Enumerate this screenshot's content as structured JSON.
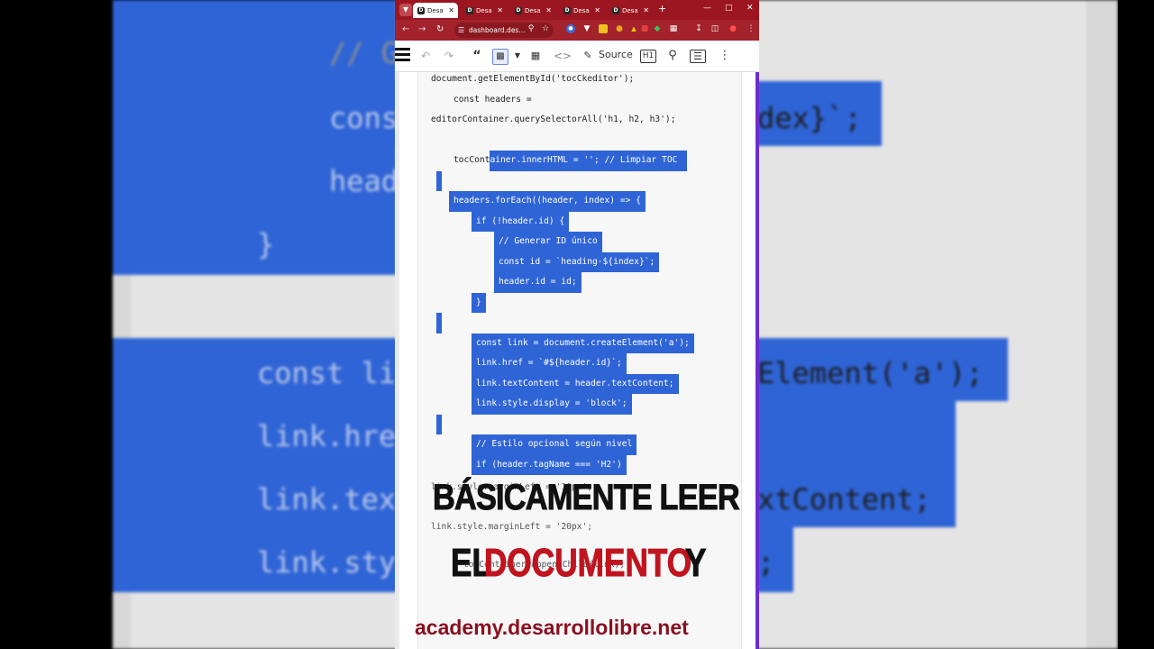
{
  "browser": {
    "tabs": [
      {
        "label": "Desa",
        "active": true
      },
      {
        "label": "Desa",
        "active": false
      },
      {
        "label": "Desa",
        "active": false
      },
      {
        "label": "Desa",
        "active": false
      },
      {
        "label": "Desa",
        "active": false
      }
    ],
    "tab_favicon": "D",
    "address": "dashboard.des...",
    "accent_color": "#9b1620"
  },
  "toolbar": {
    "source_label": "Source",
    "heading_label": "H1",
    "icons": [
      "undo-icon",
      "redo-icon",
      "blockquote-icon",
      "select-all-icon",
      "dropdown-icon",
      "html-embed-icon",
      "code-icon",
      "source-icon",
      "heading-icon",
      "find-icon",
      "show-blocks-icon",
      "more-icon"
    ]
  },
  "code_lines": [
    {
      "text": "document.getElementById('tocCkeditor');",
      "indent": 0,
      "selected": false
    },
    {
      "text": "const headers =",
      "indent": 1,
      "selected": false
    },
    {
      "text": "editorContainer.querySelectorAll('h1, h2, h3');",
      "indent": 0,
      "selected": false
    },
    {
      "text": "",
      "indent": 0,
      "selected": false
    },
    {
      "text": "tocContainer.innerHTML = ''; // Limpiar TOC",
      "indent": 1,
      "selected": "partial"
    },
    {
      "text": "",
      "indent": 0,
      "selected": true
    },
    {
      "text": "headers.forEach((header, index) => {",
      "indent": 1,
      "selected": true
    },
    {
      "text": "if (!header.id) {",
      "indent": 2,
      "selected": true
    },
    {
      "text": "// Generar ID único",
      "indent": 3,
      "selected": true
    },
    {
      "text": "const id = `heading-${index}`;",
      "indent": 3,
      "selected": true
    },
    {
      "text": "header.id = id;",
      "indent": 3,
      "selected": true
    },
    {
      "text": "}",
      "indent": 2,
      "selected": true
    },
    {
      "text": "",
      "indent": 0,
      "selected": true
    },
    {
      "text": "const link = document.createElement('a');",
      "indent": 2,
      "selected": true
    },
    {
      "text": "link.href = `#${header.id}`;",
      "indent": 2,
      "selected": true
    },
    {
      "text": "link.textContent = header.textContent;",
      "indent": 2,
      "selected": true
    },
    {
      "text": "link.style.display = 'block';",
      "indent": 2,
      "selected": true
    },
    {
      "text": "",
      "indent": 0,
      "selected": true
    },
    {
      "text": "// Estilo opcional según nivel",
      "indent": 2,
      "selected": true
    },
    {
      "text": "if (header.tagName === 'H2')",
      "indent": 2,
      "selected": true
    }
  ],
  "faded_lines": [
    "link.style.marginLeft = '10px';",
    "link.style.marginLeft = '20px';",
    "tocContainer.appendChild(link);"
  ],
  "background_code": {
    "c1": "// G",
    "c2": "cons",
    "c3": "dex}`;",
    "c4": "head",
    "c5": "}",
    "c6": "const li",
    "c7": "Element('a');",
    "c8": "link.hre",
    "c9": "link.tex",
    "c10": "xtContent;",
    "c11": "link.sty",
    "c12": ";"
  },
  "captions": {
    "line1": "BÁSICAMENTE LEER",
    "line2_part1": "EL",
    "line2_part2": "DOCUMENTO",
    "line2_part3": "Y",
    "highlight_color": "#c0141f",
    "website": "academy.desarrollolibre.net"
  }
}
